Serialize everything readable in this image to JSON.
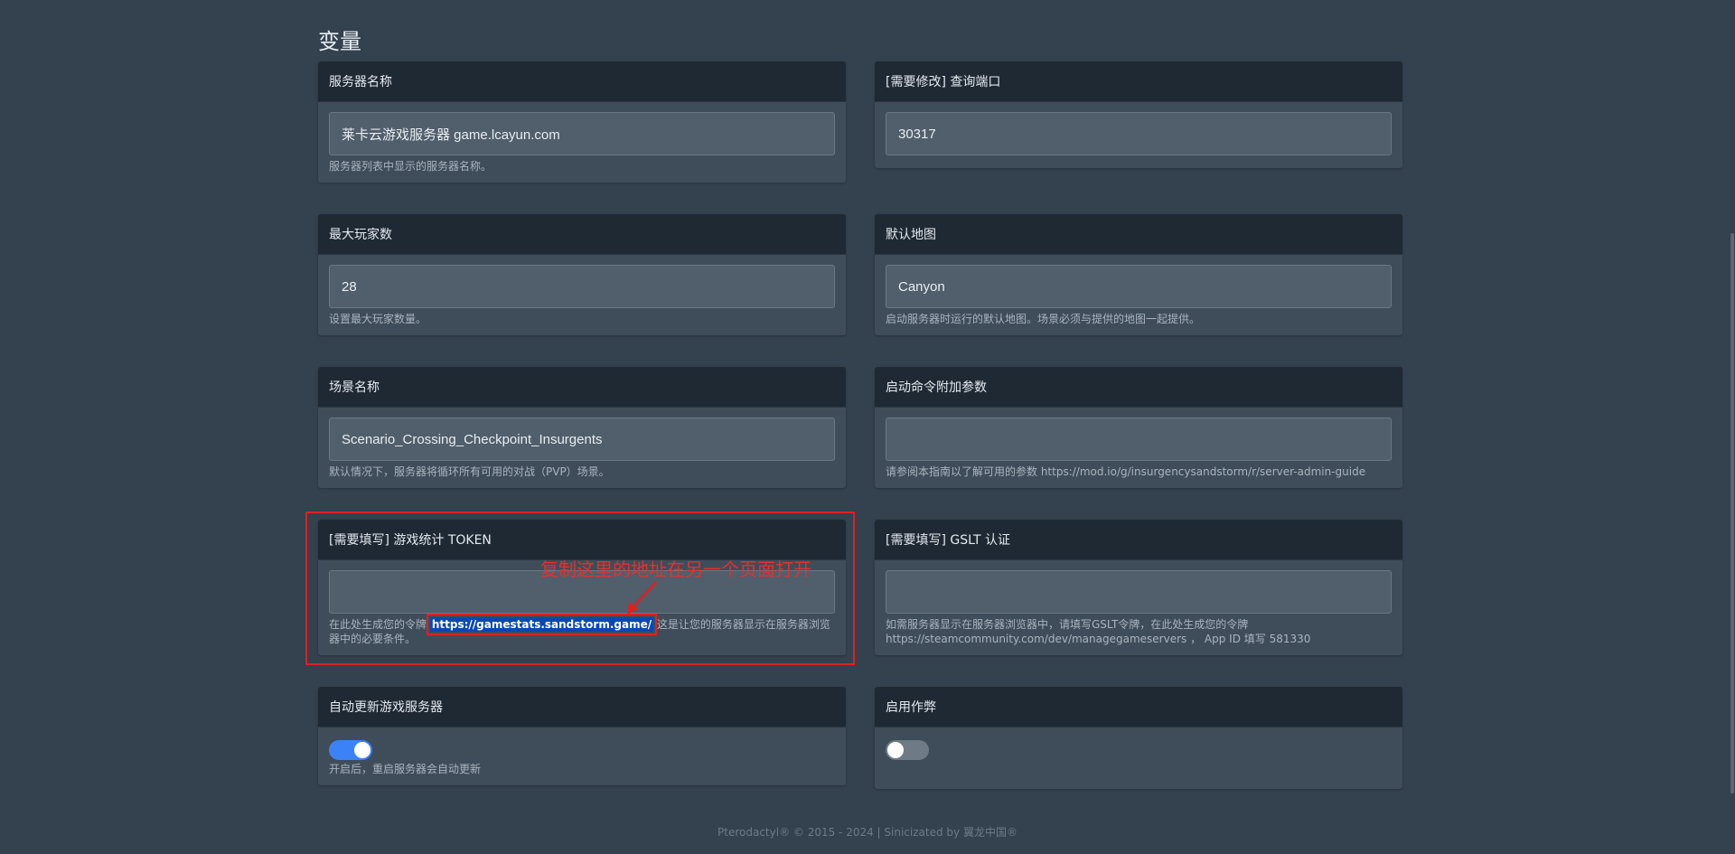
{
  "page": {
    "title": "变量"
  },
  "variables": [
    {
      "label": "服务器名称",
      "value": "莱卡云游戏服务器 game.lcayun.com",
      "help": "服务器列表中显示的服务器名称。"
    },
    {
      "label": "[需要修改] 查询端口",
      "value": "30317",
      "help": ""
    },
    {
      "label": "最大玩家数",
      "value": "28",
      "help": "设置最大玩家数量。"
    },
    {
      "label": "默认地图",
      "value": "Canyon",
      "help": "启动服务器时运行的默认地图。场景必须与提供的地图一起提供。"
    },
    {
      "label": "场景名称",
      "value": "Scenario_Crossing_Checkpoint_Insurgents",
      "help": "默认情况下，服务器将循环所有可用的对战（PVP）场景。"
    },
    {
      "label": "启动命令附加参数",
      "value": "",
      "help": "请参阅本指南以了解可用的参数 https://mod.io/g/insurgencysandstorm/r/server-admin-guide"
    },
    {
      "label": "[需要填写] 游戏统计 TOKEN",
      "value": "",
      "help_prefix": "在此处生成您的令牌",
      "help_link": "https://gamestats.sandstorm.game/",
      "help_suffix": "这是让您的服务器显示在服务器浏览器中的必要条件。"
    },
    {
      "label": "[需要填写] GSLT 认证",
      "value": "",
      "help": "如需服务器显示在服务器浏览器中，请填写GSLT令牌，在此处生成您的令牌 https://steamcommunity.com/dev/managegameservers ， App ID 填写 581330"
    },
    {
      "label": "自动更新游戏服务器",
      "toggle": true,
      "help": "开启后，重启服务器会自动更新"
    },
    {
      "label": "启用作弊",
      "toggle": false,
      "help": ""
    }
  ],
  "annotation": {
    "text": "复制这里的地址在另一个页面打开",
    "color": "#e02020"
  },
  "footer": {
    "text": "Pterodactyl® © 2015 - 2024 | Sinicizated by 翼龙中国®"
  }
}
